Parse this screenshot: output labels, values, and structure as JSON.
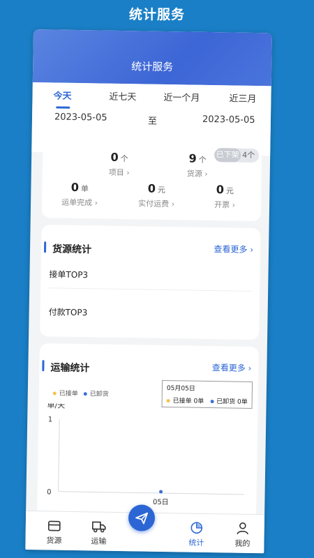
{
  "outer_title": "统计服务",
  "header": {
    "title": "统计服务"
  },
  "tabs": [
    {
      "label": "今天",
      "active": true
    },
    {
      "label": "近七天",
      "active": false
    },
    {
      "label": "近一个月",
      "active": false
    },
    {
      "label": "近三月",
      "active": false
    }
  ],
  "date_range": {
    "start": "2023-05-05",
    "separator": "至",
    "end": "2023-05-05"
  },
  "summary": {
    "projects": {
      "value": "0",
      "unit": "个",
      "label": "项目 ›"
    },
    "sources": {
      "value": "9",
      "unit": "个",
      "label": "货源 ›"
    },
    "offline_badge": {
      "label": "已下架",
      "count": "4个"
    },
    "orders_done": {
      "value": "0",
      "unit": "单",
      "label": "运单完成 ›"
    },
    "freight_paid": {
      "value": "0",
      "unit": "元",
      "label": "实付运费 ›"
    },
    "invoice": {
      "value": "0",
      "unit": "元",
      "label": "开票 ›"
    }
  },
  "source_stats": {
    "title": "货源统计",
    "more": "查看更多 ›",
    "items": [
      "接单TOP3",
      "付款TOP3"
    ]
  },
  "transport_stats": {
    "title": "运输统计",
    "more": "查看更多 ›",
    "legend": [
      "已接单",
      "已卸货"
    ],
    "tooltip": {
      "date": "05月05日",
      "row": [
        {
          "label": "已接单",
          "value": "0单"
        },
        {
          "label": "已卸货",
          "value": "0单"
        }
      ]
    },
    "colors": {
      "accepted": "#f5c24a",
      "unloaded": "#3d6fd8"
    }
  },
  "chart_data": {
    "type": "line",
    "ylabel": "单/天",
    "categories": [
      "05日"
    ],
    "series": [
      {
        "name": "已接单",
        "values": [
          0
        ]
      },
      {
        "name": "已卸货",
        "values": [
          0
        ]
      }
    ],
    "ytick_labels": [
      "0",
      "1"
    ],
    "ylim": [
      0,
      1
    ],
    "grid": false
  },
  "navbar": [
    {
      "label": "货源",
      "icon": "box-icon",
      "active": false
    },
    {
      "label": "运输",
      "icon": "truck-icon",
      "active": false
    },
    {
      "label": "",
      "icon": "send-icon",
      "active": false
    },
    {
      "label": "统计",
      "icon": "pie-chart-icon",
      "active": true
    },
    {
      "label": "我的",
      "icon": "user-icon",
      "active": false
    }
  ],
  "accent_color": "#2c66d4"
}
